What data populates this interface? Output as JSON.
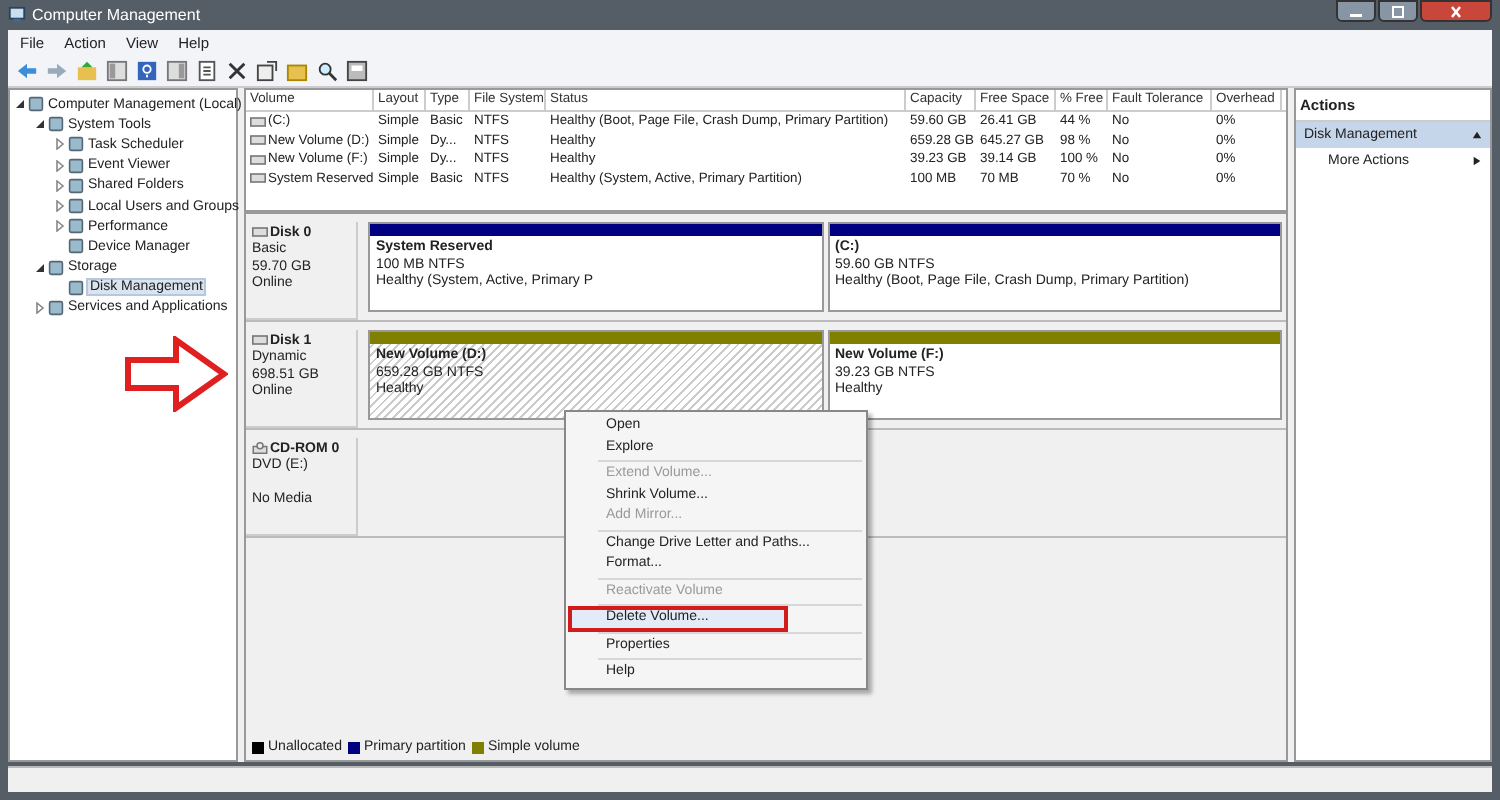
{
  "window": {
    "title": "Computer Management"
  },
  "menu": [
    "File",
    "Action",
    "View",
    "Help"
  ],
  "tree": [
    {
      "label": "Computer Management (Local)",
      "selected": false,
      "expanded": true,
      "children": [
        {
          "label": "System Tools",
          "selected": false,
          "expanded": true,
          "children": [
            {
              "label": "Task Scheduler",
              "selected": false,
              "expanded": false
            },
            {
              "label": "Event Viewer",
              "selected": false,
              "expanded": false
            },
            {
              "label": "Shared Folders",
              "selected": false,
              "expanded": false
            },
            {
              "label": "Local Users and Groups",
              "selected": false,
              "expanded": false
            },
            {
              "label": "Performance",
              "selected": false,
              "expanded": false
            },
            {
              "label": "Device Manager",
              "selected": false
            }
          ]
        },
        {
          "label": "Storage",
          "selected": false,
          "expanded": true,
          "children": [
            {
              "label": "Disk Management",
              "selected": true
            }
          ]
        },
        {
          "label": "Services and Applications",
          "selected": false,
          "expanded": false
        }
      ]
    }
  ],
  "volumes": {
    "columns": [
      "Volume",
      "Layout",
      "Type",
      "File System",
      "Status",
      "Capacity",
      "Free Space",
      "% Free",
      "Fault Tolerance",
      "Overhead"
    ],
    "rows": [
      [
        "(C:)",
        "Simple",
        "Basic",
        "NTFS",
        "Healthy (Boot, Page File, Crash Dump, Primary Partition)",
        "59.60 GB",
        "26.41 GB",
        "44 %",
        "No",
        "0%"
      ],
      [
        "New Volume (D:)",
        "Simple",
        "Dy...",
        "NTFS",
        "Healthy",
        "659.28 GB",
        "645.27 GB",
        "98 %",
        "No",
        "0%"
      ],
      [
        "New Volume (F:)",
        "Simple",
        "Dy...",
        "NTFS",
        "Healthy",
        "39.23 GB",
        "39.14 GB",
        "100 %",
        "No",
        "0%"
      ],
      [
        "System Reserved",
        "Simple",
        "Basic",
        "NTFS",
        "Healthy (System, Active, Primary Partition)",
        "100 MB",
        "70 MB",
        "70 %",
        "No",
        "0%"
      ]
    ]
  },
  "disks": [
    {
      "kind": "disk",
      "name": "Disk 0",
      "lines": [
        "Basic",
        "59.70 GB",
        "Online"
      ],
      "partitions": [
        {
          "name": "System Reserved",
          "detail": "100 MB NTFS",
          "health": "Healthy (System, Active, Primary P",
          "color": "#000080",
          "selected": false
        },
        {
          "name": "(C:)",
          "detail": "59.60 GB NTFS",
          "health": "Healthy (Boot, Page File, Crash Dump, Primary Partition)",
          "color": "#000080",
          "selected": false
        }
      ]
    },
    {
      "kind": "disk",
      "name": "Disk 1",
      "lines": [
        "Dynamic",
        "698.51 GB",
        "Online"
      ],
      "partitions": [
        {
          "name": "New Volume  (D:)",
          "detail": "659.28 GB NTFS",
          "health": "Healthy",
          "color": "#808000",
          "selected": true
        },
        {
          "name": "New Volume  (F:)",
          "detail": "39.23 GB NTFS",
          "health": "Healthy",
          "color": "#808000",
          "selected": false
        }
      ]
    },
    {
      "kind": "cdrom",
      "name": "CD-ROM 0",
      "lines": [
        "DVD (E:)",
        "No Media"
      ]
    }
  ],
  "legend": [
    {
      "label": "Unallocated",
      "color": "#000000"
    },
    {
      "label": "Primary partition",
      "color": "#000080"
    },
    {
      "label": "Simple volume",
      "color": "#808000"
    }
  ],
  "context_menu": [
    {
      "kind": "item",
      "label": "Open",
      "disabled": false,
      "highlighted": false
    },
    {
      "kind": "item",
      "label": "Explore",
      "disabled": false,
      "highlighted": false
    },
    {
      "kind": "separator"
    },
    {
      "kind": "item",
      "label": "Extend Volume...",
      "disabled": true,
      "highlighted": false
    },
    {
      "kind": "item",
      "label": "Shrink Volume...",
      "disabled": false,
      "highlighted": false
    },
    {
      "kind": "item",
      "label": "Add Mirror...",
      "disabled": true,
      "highlighted": false
    },
    {
      "kind": "separator"
    },
    {
      "kind": "item",
      "label": "Change Drive Letter and Paths...",
      "disabled": false,
      "highlighted": false
    },
    {
      "kind": "item",
      "label": "Format...",
      "disabled": false,
      "highlighted": false
    },
    {
      "kind": "separator"
    },
    {
      "kind": "item",
      "label": "Reactivate Volume",
      "disabled": true,
      "highlighted": false
    },
    {
      "kind": "separator"
    },
    {
      "kind": "item",
      "label": "Delete Volume...",
      "disabled": false,
      "highlighted": true
    },
    {
      "kind": "separator"
    },
    {
      "kind": "item",
      "label": "Properties",
      "disabled": false,
      "highlighted": false
    },
    {
      "kind": "separator"
    },
    {
      "kind": "item",
      "label": "Help",
      "disabled": false,
      "highlighted": false
    }
  ],
  "actions": {
    "title": "Actions",
    "section": "Disk Management",
    "items": [
      "More Actions"
    ]
  }
}
